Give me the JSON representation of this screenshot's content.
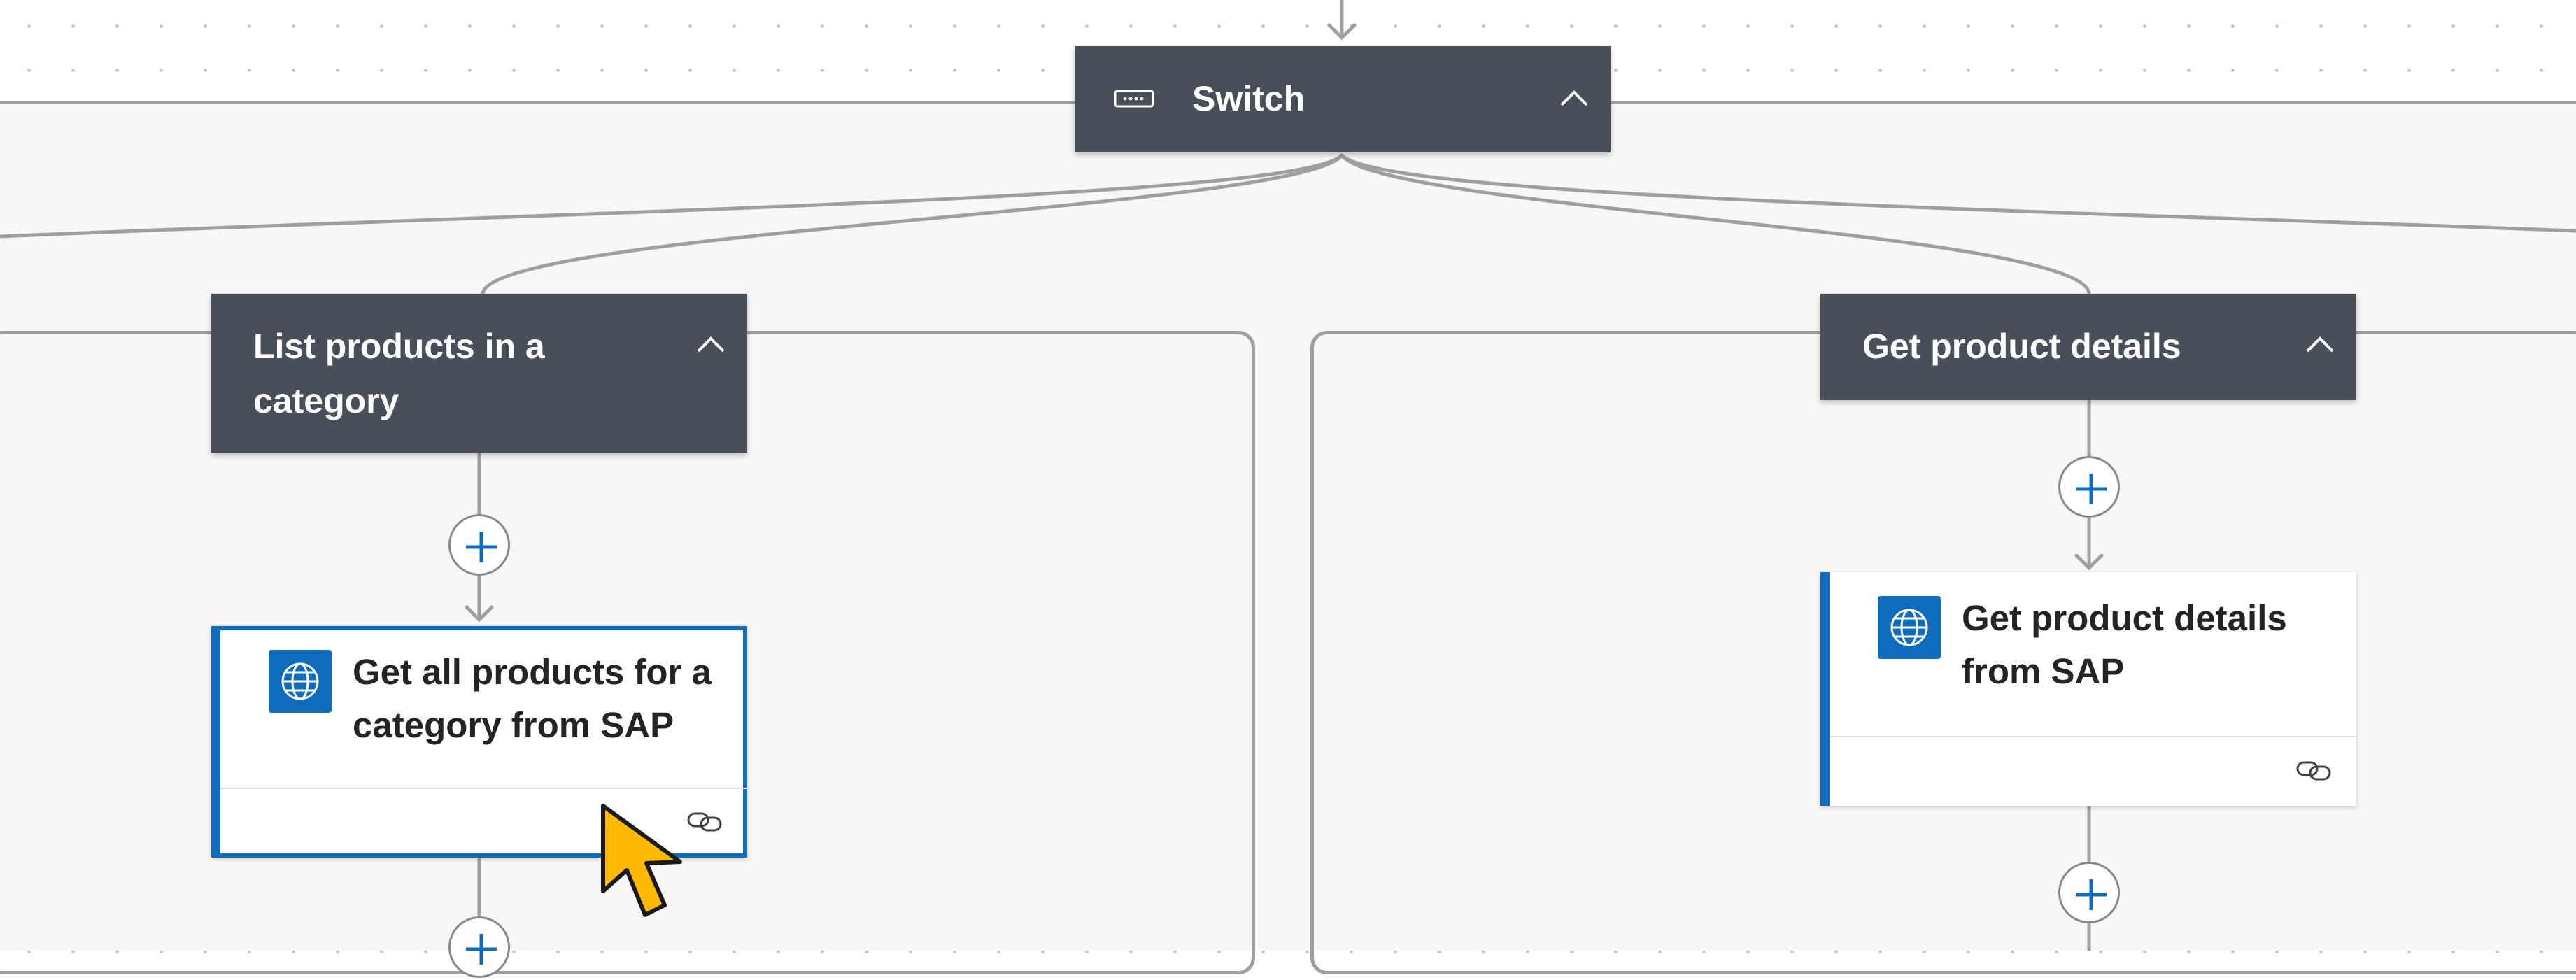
{
  "switch_node": {
    "title": "Switch",
    "icon": "switch-icon",
    "chevron": "chevron-up-icon"
  },
  "cases": [
    {
      "title": "List products in a category",
      "action": {
        "title": "Get all products for a category from SAP",
        "icon": "globe-icon",
        "footer_icon": "link-icon",
        "selected": true
      }
    },
    {
      "title": "Get product details",
      "action": {
        "title": "Get product details from SAP",
        "icon": "globe-icon",
        "footer_icon": "link-icon",
        "selected": false
      }
    }
  ],
  "colors": {
    "header_bg": "#484f58",
    "accent": "#0f6cbd",
    "connector": "#a19f9d",
    "canvas_panel": "#f8f7f6",
    "cursor": "#ffb900"
  }
}
